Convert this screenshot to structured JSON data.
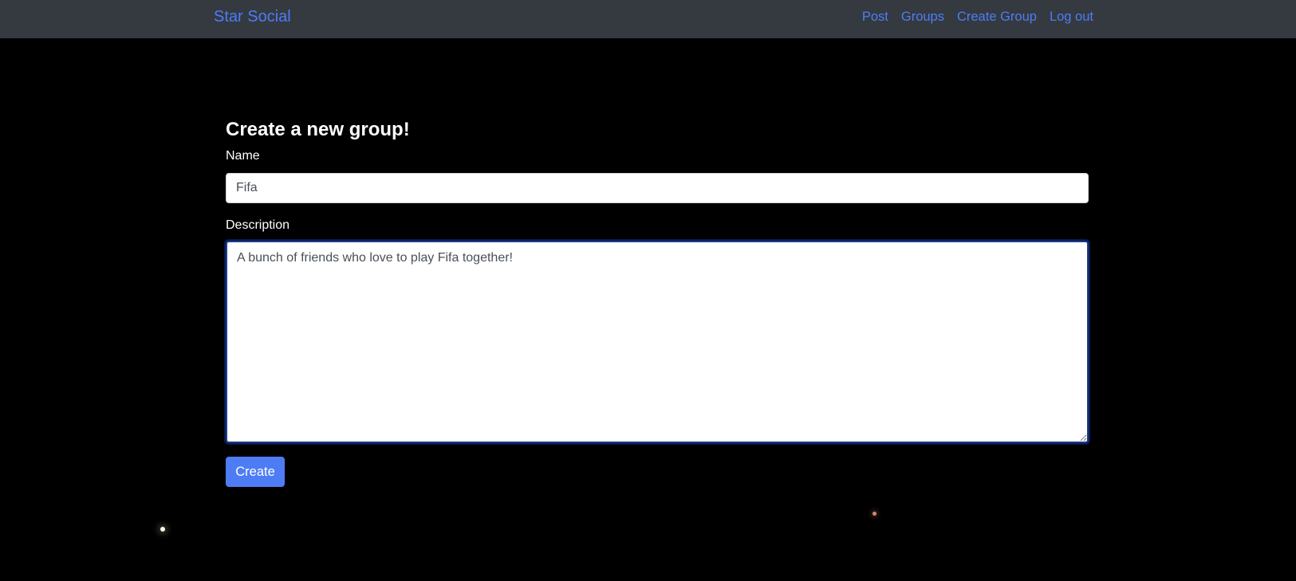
{
  "navbar": {
    "brand": "Star Social",
    "links": [
      {
        "label": "Post"
      },
      {
        "label": "Groups"
      },
      {
        "label": "Create Group"
      },
      {
        "label": "Log out"
      }
    ]
  },
  "form": {
    "title": "Create a new group!",
    "name_label": "Name",
    "name_value": "Fifa",
    "description_label": "Description",
    "description_value": "A bunch of friends who love to play Fifa together!",
    "submit_label": "Create"
  },
  "colors": {
    "navbar_bg": "#343a40",
    "page_bg": "#000000",
    "link": "#4e7cf5",
    "button": "#4e7cf5",
    "focus_border": "#1c3a8a"
  }
}
